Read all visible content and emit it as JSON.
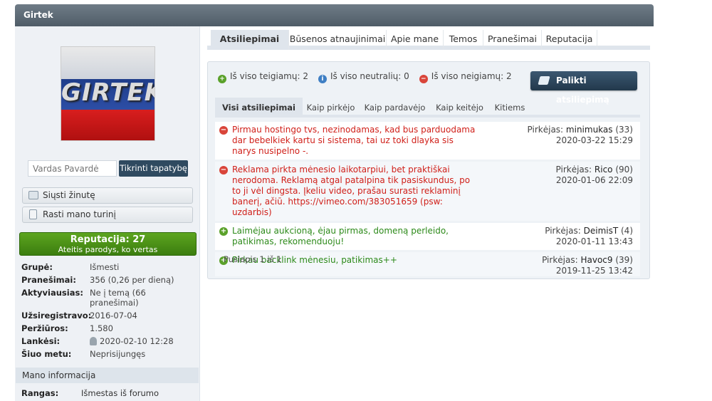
{
  "header": {
    "title": "Girtek"
  },
  "profile": {
    "avatar_text": "GIRTEK",
    "verify": {
      "placeholder": "Vardas Pavardė",
      "button": "Tikrinti tapatybę"
    },
    "actions": [
      {
        "label": "Siųsti žinutę",
        "icon": "envelope-icon"
      },
      {
        "label": "Rasti mano turinį",
        "icon": "document-icon"
      }
    ],
    "reputation": {
      "title": "Reputacija: 27",
      "subtitle": "Ateitis parodys, ko vertas"
    },
    "info": [
      {
        "key": "Grupė:",
        "value": "Išmesti"
      },
      {
        "key": "Pranešimai:",
        "value": "356 (0,26 per dieną)"
      },
      {
        "key": "Aktyviausias:",
        "value": "Ne į temą (66 pranešimai)"
      },
      {
        "key": "Užsiregistravo:",
        "value": "2016-07-04"
      },
      {
        "key": "Peržiūros:",
        "value": "1.580"
      },
      {
        "key": "Lankėsi:",
        "value": "2020-02-10 12:28"
      },
      {
        "key": "Šiuo metu:",
        "value": "Neprisijungęs"
      }
    ],
    "section_title": "Mano informacija",
    "rank": {
      "key": "Rangas:",
      "value": "Išmestas iš forumo"
    }
  },
  "tabs": [
    "Atsiliepimai",
    "Būsenos atnaujinimai",
    "Apie mane",
    "Temos",
    "Pranešimai",
    "Reputacija"
  ],
  "feedback": {
    "stats": {
      "positive": "Iš viso teigiamų: 2",
      "neutral": "Iš viso neutralių: 0",
      "negative": "Iš viso neigiamų: 2"
    },
    "leave_button": "Palikti atsiliepimą",
    "subtabs": [
      "Visi atsiliepimai",
      "Kaip pirkėjo",
      "Kaip pardavėjo",
      "Kaip keitėjo",
      "Kitiems"
    ],
    "items": [
      {
        "type": "neg",
        "comment": "Pirmau hostingo tvs, nezinodamas, kad bus parduodama dar bebelkiek kartu si sistema, tai uz toki dlayka sis narys nusipelno -.",
        "role": "Pirkėjas:",
        "user": "minimukas",
        "score": "(33)",
        "date": "2020-03-22 15:29"
      },
      {
        "type": "neg",
        "comment": "Reklama pirkta mėnesio laikotarpiui, bet praktiškai nerodoma. Reklamą atgal patalpina tik pasiskundus, po to ji vėl dingsta. Įkeliu video, prašau surasti reklaminį banerį, ačiū. https://vimeo.com/383051659 (psw: uzdarbis)",
        "role": "Pirkėjas:",
        "user": "Rico",
        "score": "(90)",
        "date": "2020-01-06 22:09"
      },
      {
        "type": "pos",
        "comment": "Laimėjau aukcioną, ėjau pirmas, domeną perleido, patikimas, rekomenduoju!",
        "role": "Pirkėjas:",
        "user": "DeimisT",
        "score": "(4)",
        "date": "2020-01-11 13:43"
      },
      {
        "type": "pos",
        "comment": "Pirkau backlink mėnesiu, patikimas++",
        "role": "Pirkėjas:",
        "user": "Havoc9",
        "score": "(39)",
        "date": "2019-11-25 13:42"
      }
    ],
    "pagination": "Puslapis 1 iš 1"
  }
}
